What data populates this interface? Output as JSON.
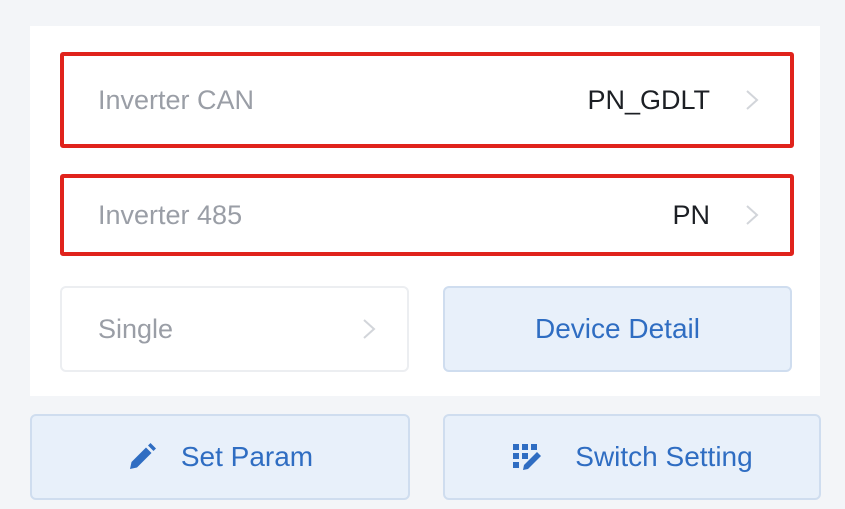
{
  "inverter_can": {
    "label": "Inverter CAN",
    "value": "PN_GDLT"
  },
  "inverter_485": {
    "label": "Inverter 485",
    "value": "PN"
  },
  "mode": {
    "label": "Single"
  },
  "buttons": {
    "device_detail": "Device Detail",
    "set_param": "Set Param",
    "switch_setting": "Switch Setting"
  },
  "icons": {
    "set_param": "pencil-icon",
    "switch_setting": "grid-edit-icon",
    "row_arrow": "chevron-right-icon"
  },
  "colors": {
    "accent": "#2f6dc2",
    "highlight_border": "#e0231c",
    "button_bg": "#e8f0fa"
  }
}
